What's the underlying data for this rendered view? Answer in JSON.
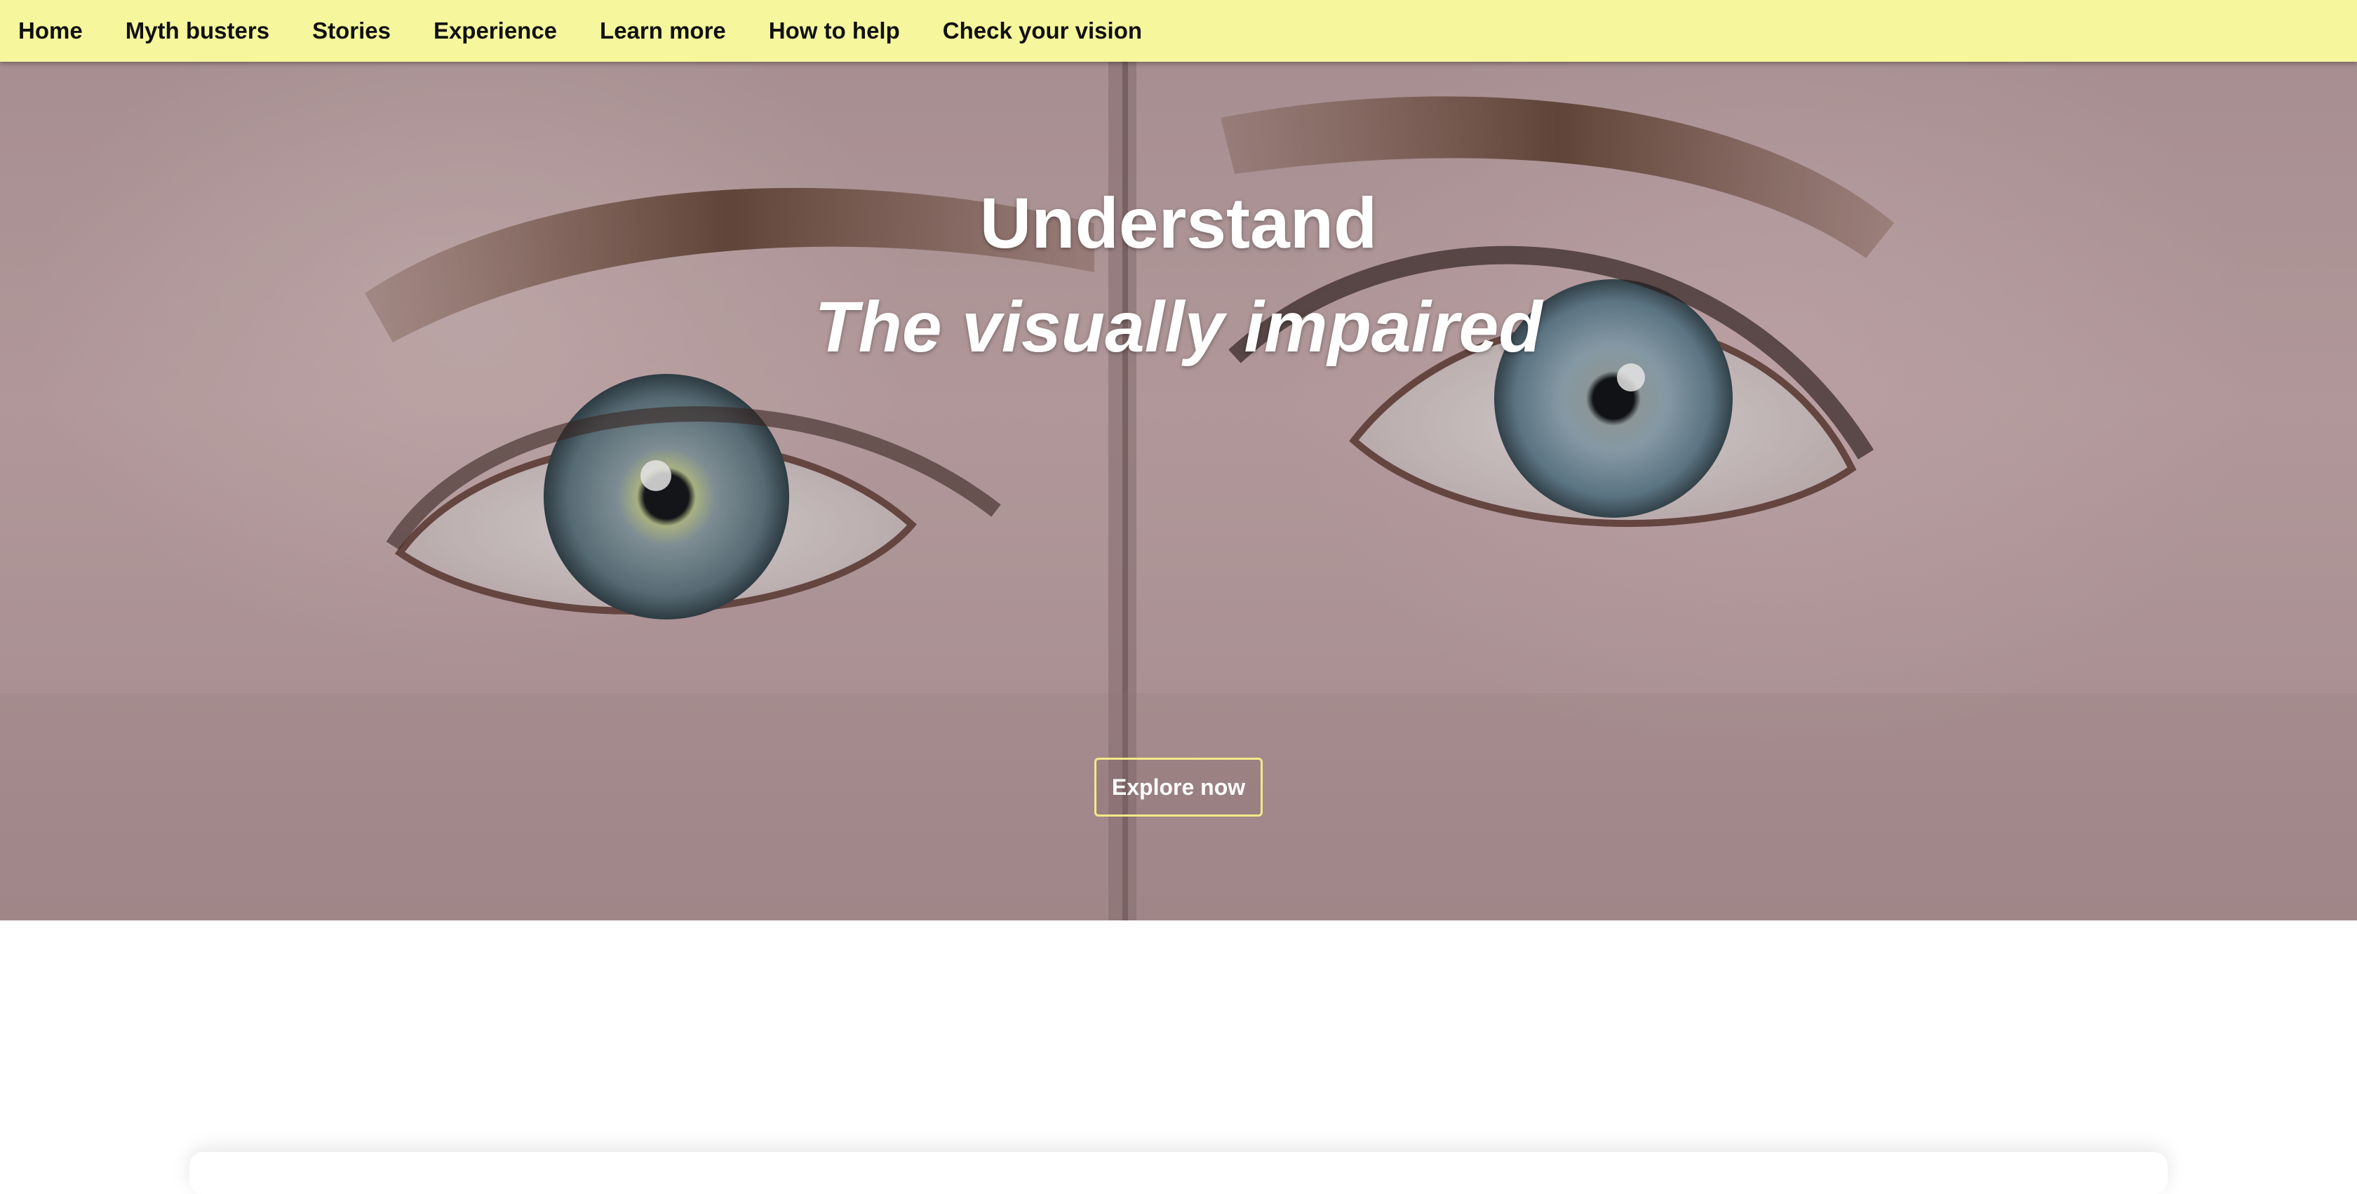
{
  "nav": {
    "items": [
      {
        "label": "Home"
      },
      {
        "label": "Myth busters"
      },
      {
        "label": "Stories"
      },
      {
        "label": "Experience"
      },
      {
        "label": "Learn more"
      },
      {
        "label": "How to help"
      },
      {
        "label": "Check your vision"
      }
    ],
    "background_color": "#f6f69c"
  },
  "hero": {
    "title": "Understand",
    "subtitle": "The visually impaired",
    "cta_label": "Explore now",
    "cta_border_color": "#f1e98a"
  }
}
